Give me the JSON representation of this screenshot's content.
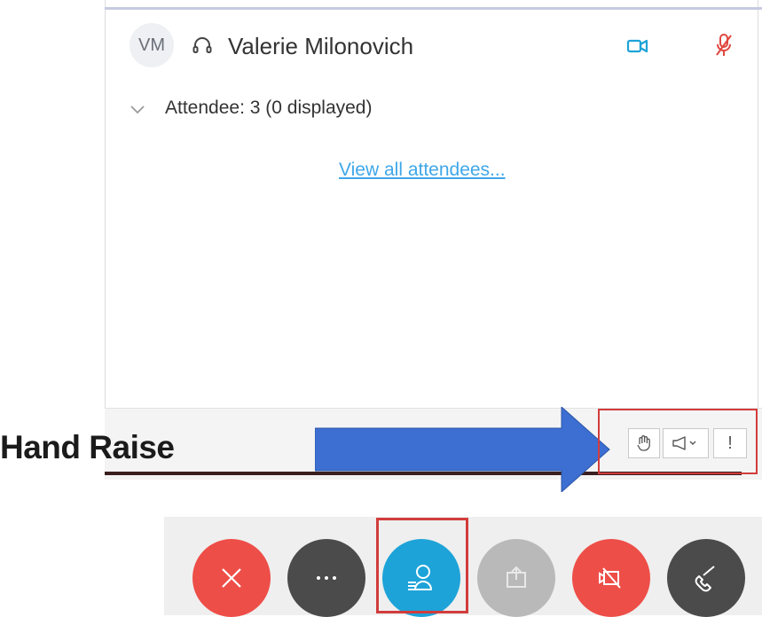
{
  "participant": {
    "initials": "VM",
    "name": "Valerie Milonovich"
  },
  "attendees": {
    "summary": "Attendee: 3 (0 displayed)",
    "view_all_link": "View all attendees..."
  },
  "annotation": {
    "label": "Hand Raise"
  },
  "toolbar": {
    "more_label": "!"
  },
  "controls": {
    "leave": "close-icon",
    "more": "ellipsis-icon",
    "participants": "participants-icon",
    "share": "share-icon",
    "video_off": "video-off-icon",
    "call": "phone-icon"
  },
  "colors": {
    "accent_blue": "#1da3d8",
    "danger_red": "#ee4e48",
    "arrow_blue": "#3c6fd1",
    "highlight_red": "#d23c3c"
  }
}
